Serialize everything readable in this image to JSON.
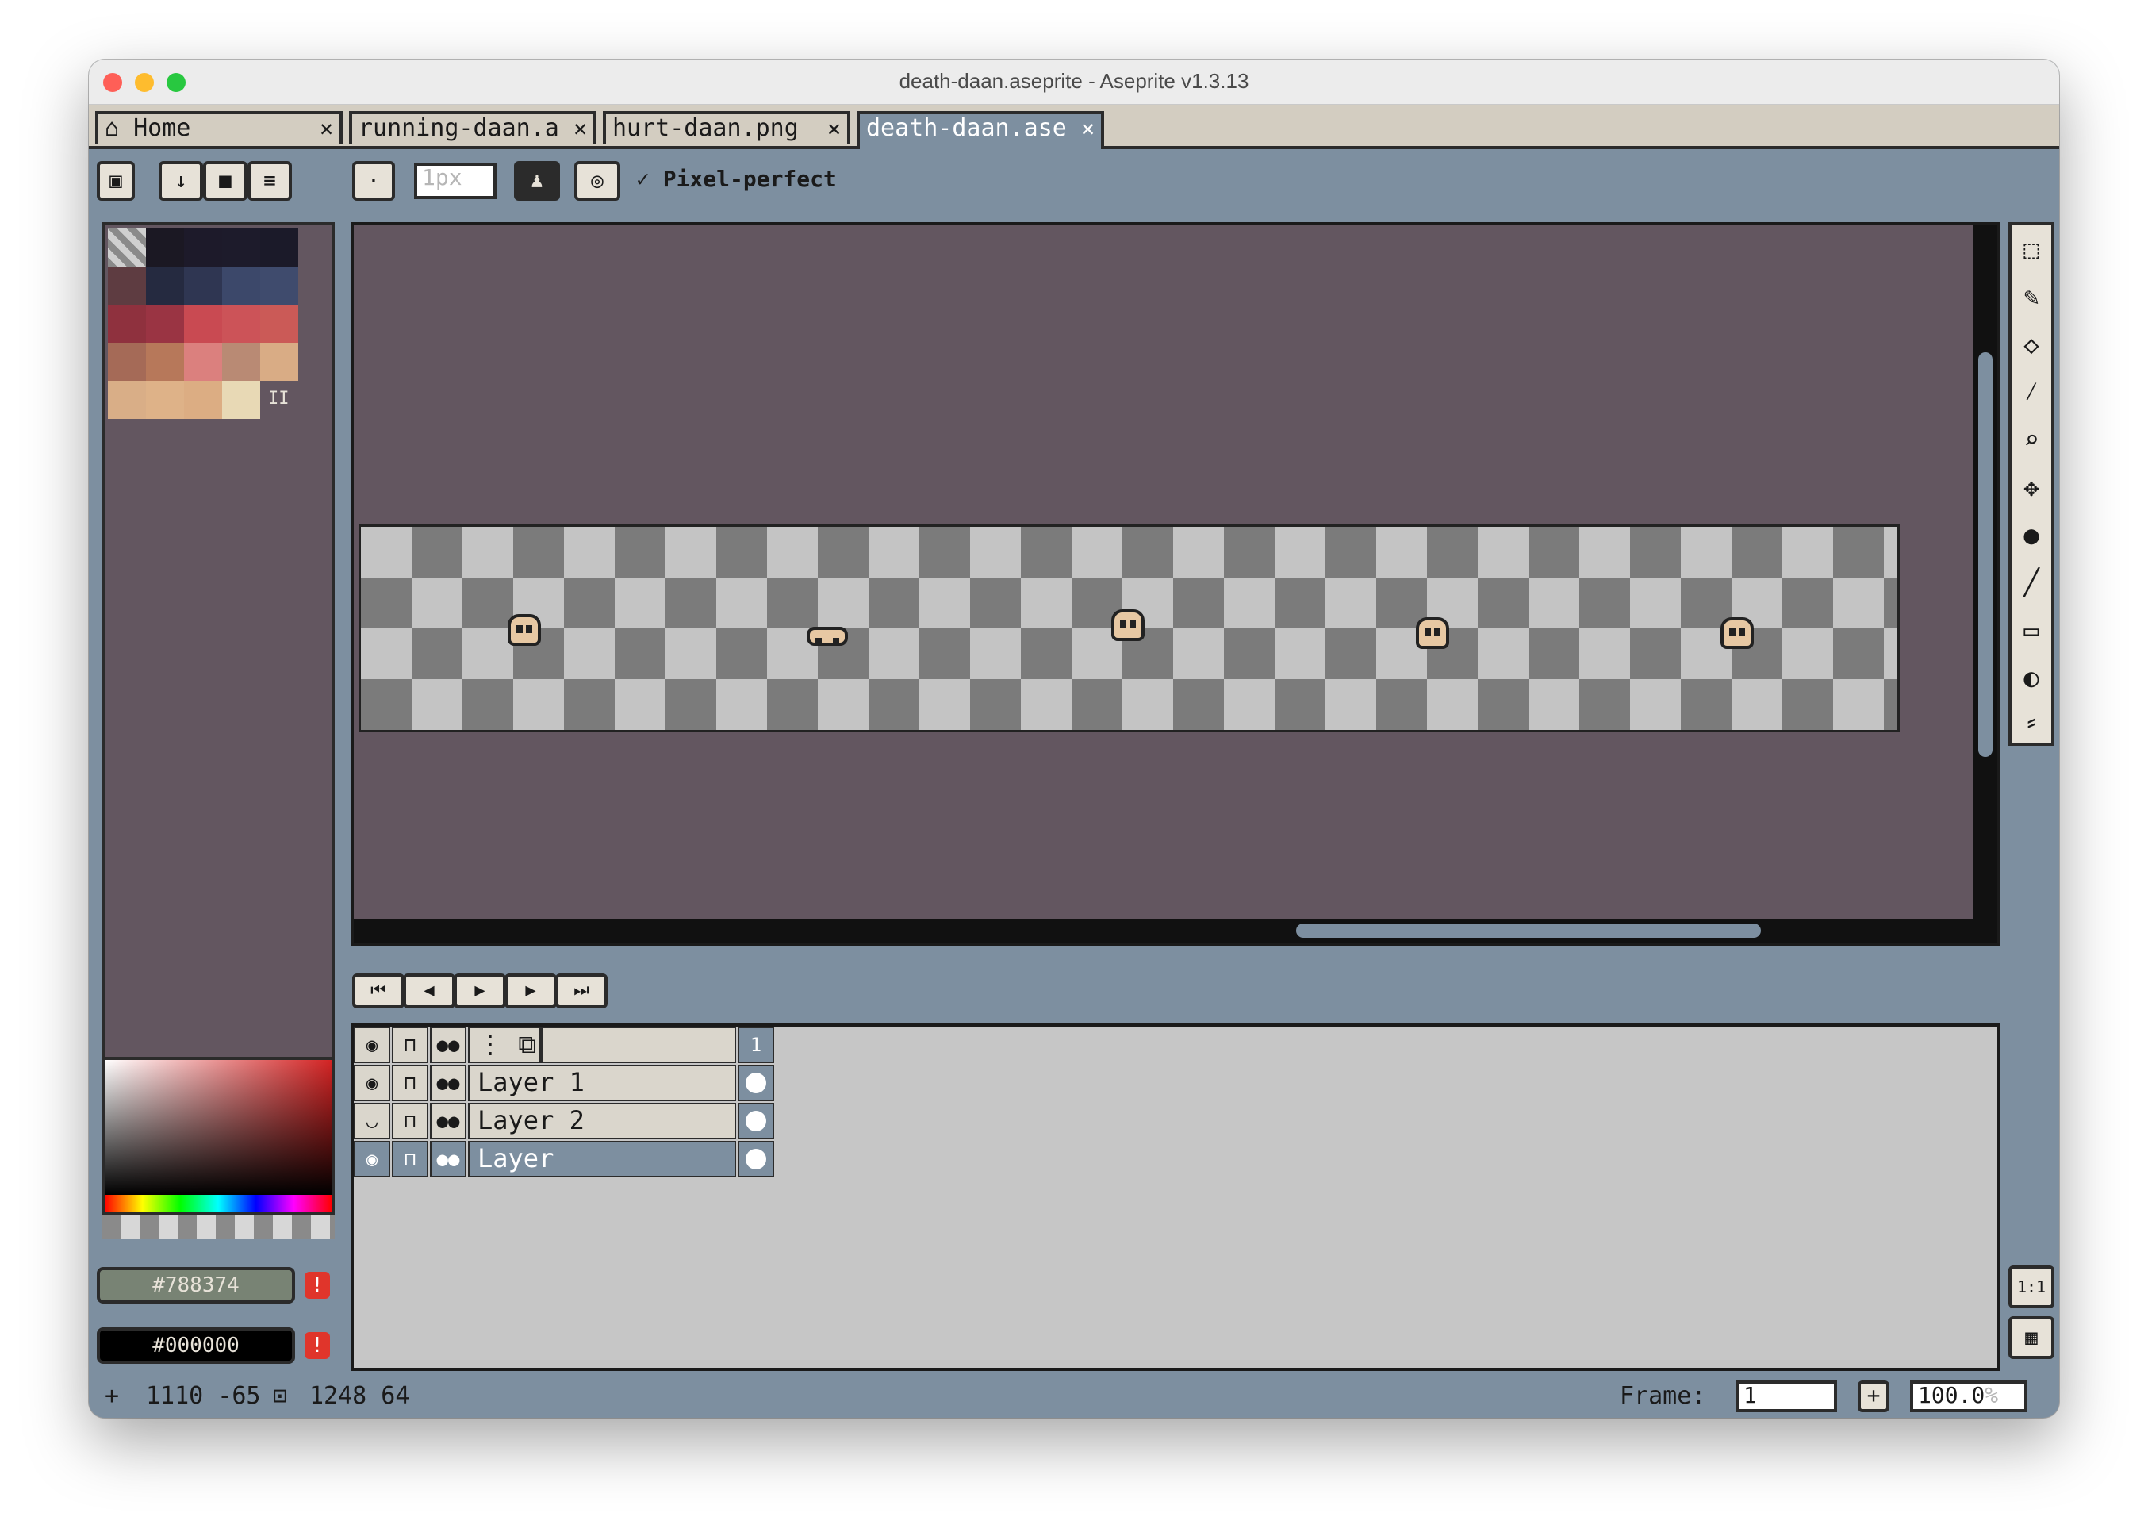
{
  "window": {
    "title": "death-daan.aseprite - Aseprite v1.3.13"
  },
  "tabs": [
    {
      "label": "Home",
      "icon": "home-icon"
    },
    {
      "label": "running-daan.a"
    },
    {
      "label": "hurt-daan.png"
    },
    {
      "label": "death-daan.ase"
    }
  ],
  "tab_close": "✕",
  "toolbar": {
    "brush_size": "1px",
    "pixel_perfect_label": "Pixel-perfect",
    "pixel_perfect_checked": true
  },
  "palette": {
    "colors": [
      "#1b1823",
      "#1d1a2a",
      "#1d1b2b",
      "#1b1a29",
      "#5e3c41",
      "#252a40",
      "#2f3652",
      "#3c486a",
      "#3f4b6d",
      "#8f313e",
      "#9a3443",
      "#c94a52",
      "#cc5358",
      "#cb5a57",
      "#a56a57",
      "#b7785a",
      "#db807e",
      "#b98a74",
      "#d9ac85",
      "#d9ae87",
      "#deb288",
      "#dcad83",
      "#e8d9b5"
    ],
    "more_indicator": "II"
  },
  "colors": {
    "foreground_hex": "#788374",
    "background_hex": "#000000",
    "warn_symbol": "!"
  },
  "playback": [
    "first-frame-icon",
    "prev-frame-icon",
    "play-icon",
    "next-frame-icon",
    "last-frame-icon"
  ],
  "timeline": {
    "frame_header": "1",
    "layers": [
      {
        "name": "Layer 1",
        "visible": true,
        "selected": false
      },
      {
        "name": "Layer 2",
        "visible": false,
        "selected": false
      },
      {
        "name": "Layer",
        "visible": true,
        "selected": true
      }
    ]
  },
  "status": {
    "cursor_pos": "1110 -65",
    "canvas_size": "1248 64",
    "frame_label": "Frame:",
    "frame_value": "1",
    "add_frame": "+",
    "zoom": "100.0",
    "zoom_unit": "%"
  },
  "side_buttons": {
    "one_to_one": "1:1"
  }
}
